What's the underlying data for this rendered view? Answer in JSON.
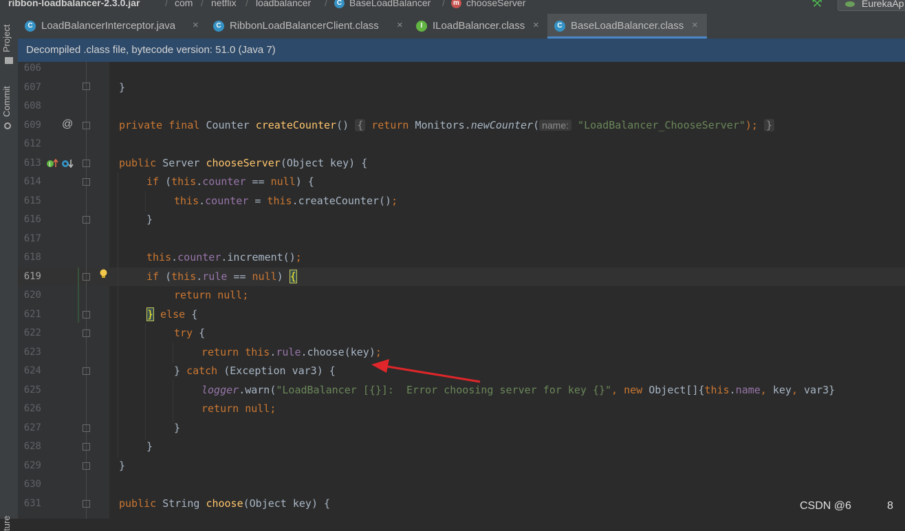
{
  "breadcrumb": {
    "items": [
      "ribbon-loadbalancer-2.3.0.jar",
      "com",
      "netflix",
      "loadbalancer",
      "BaseLoadBalancer",
      "chooseServer"
    ],
    "separator": "/"
  },
  "run_config": {
    "label": "EurekaAp"
  },
  "tabs": [
    {
      "label": "LoadBalancerInterceptor.java",
      "icon": "C",
      "close": "×"
    },
    {
      "label": "RibbonLoadBalancerClient.class",
      "icon": "C",
      "close": "×"
    },
    {
      "label": "ILoadBalancer.class",
      "icon": "I",
      "close": "×"
    },
    {
      "label": "BaseLoadBalancer.class",
      "icon": "C",
      "close": "×"
    }
  ],
  "notice": {
    "text": "Decompiled .class file, bytecode version: 51.0 (Java 7)"
  },
  "sidebar": {
    "project_label": "Project",
    "commit_label": "Commit",
    "structure_label": "ture"
  },
  "line_numbers": [
    "606",
    "607",
    "608",
    "609",
    "612",
    "613",
    "614",
    "615",
    "616",
    "617",
    "618",
    "619",
    "620",
    "621",
    "622",
    "623",
    "624",
    "625",
    "626",
    "627",
    "628",
    "629",
    "630",
    "631"
  ],
  "current_line": "619",
  "code": {
    "l607": "}",
    "l609_a": "private final ",
    "l609_b": "Counter ",
    "l609_c": "createCounter",
    "l609_d": "() ",
    "l609_e": "{",
    "l609_f": "return ",
    "l609_g": "Monitors.",
    "l609_h": "newCounter",
    "l609_i": "(",
    "l609_hint": "name:",
    "l609_j": "\"LoadBalancer_ChooseServer\"",
    "l609_k": ");",
    "l609_l": "}",
    "l613_a": "public ",
    "l613_b": "Server ",
    "l613_c": "chooseServer",
    "l613_d": "(Object key) {",
    "l614_a": "if ",
    "l614_b": "(",
    "l614_c": "this",
    "l614_d": ".",
    "l614_e": "counter",
    "l614_f": " == ",
    "l614_g": "null",
    "l614_h": ") {",
    "l615_a": "this",
    "l615_b": ".",
    "l615_c": "counter",
    "l615_d": " = ",
    "l615_e": "this",
    "l615_f": ".createCounter()",
    "l615_g": ";",
    "l616": "}",
    "l618_a": "this",
    "l618_b": ".",
    "l618_c": "counter",
    "l618_d": ".increment()",
    "l618_e": ";",
    "l619_a": "if ",
    "l619_b": "(",
    "l619_c": "this",
    "l619_d": ".",
    "l619_e": "rule",
    "l619_f": " == ",
    "l619_g": "null",
    "l619_h": ") ",
    "l619_i": "{",
    "l620_a": "return null",
    "l620_b": ";",
    "l621_a": "}",
    "l621_b": " else ",
    "l621_c": "{",
    "l622_a": "try ",
    "l622_b": "{",
    "l623_a": "return this",
    "l623_b": ".",
    "l623_c": "rule",
    "l623_d": ".choose(key)",
    "l623_e": ";",
    "l624_a": "} ",
    "l624_b": "catch ",
    "l624_c": "(Exception var3) {",
    "l625_a": "logger",
    "l625_b": ".warn(",
    "l625_c": "\"LoadBalancer [{}]:  Error choosing server for key {}\"",
    "l625_d": ", ",
    "l625_e": "new ",
    "l625_f": "Object[]{",
    "l625_g": "this",
    "l625_h": ".",
    "l625_i": "name",
    "l625_j": ", ",
    "l625_k": "key",
    "l625_l": ", ",
    "l625_m": "var3}",
    "l626_a": "return null",
    "l626_b": ";",
    "l627": "}",
    "l628": "}",
    "l629": "}",
    "l631_a": "public ",
    "l631_b": "String ",
    "l631_c": "choose",
    "l631_d": "(Object key) {"
  },
  "gutter": {
    "override_marker": "@"
  },
  "watermark": {
    "text": "CSDN @6",
    "suffix": "8"
  },
  "colors": {
    "keyword": "#cc7832",
    "method": "#ffc66d",
    "field": "#9876aa",
    "string": "#6a8759",
    "text": "#a9b7c6",
    "arrow": "#e0262a",
    "background": "#2b2b2b"
  },
  "icons": [
    "jar-icon",
    "class-icon",
    "method-icon",
    "interface-icon",
    "lightbulb-icon",
    "override-icon",
    "implemented-icon",
    "fold-icon",
    "hammer-icon"
  ]
}
